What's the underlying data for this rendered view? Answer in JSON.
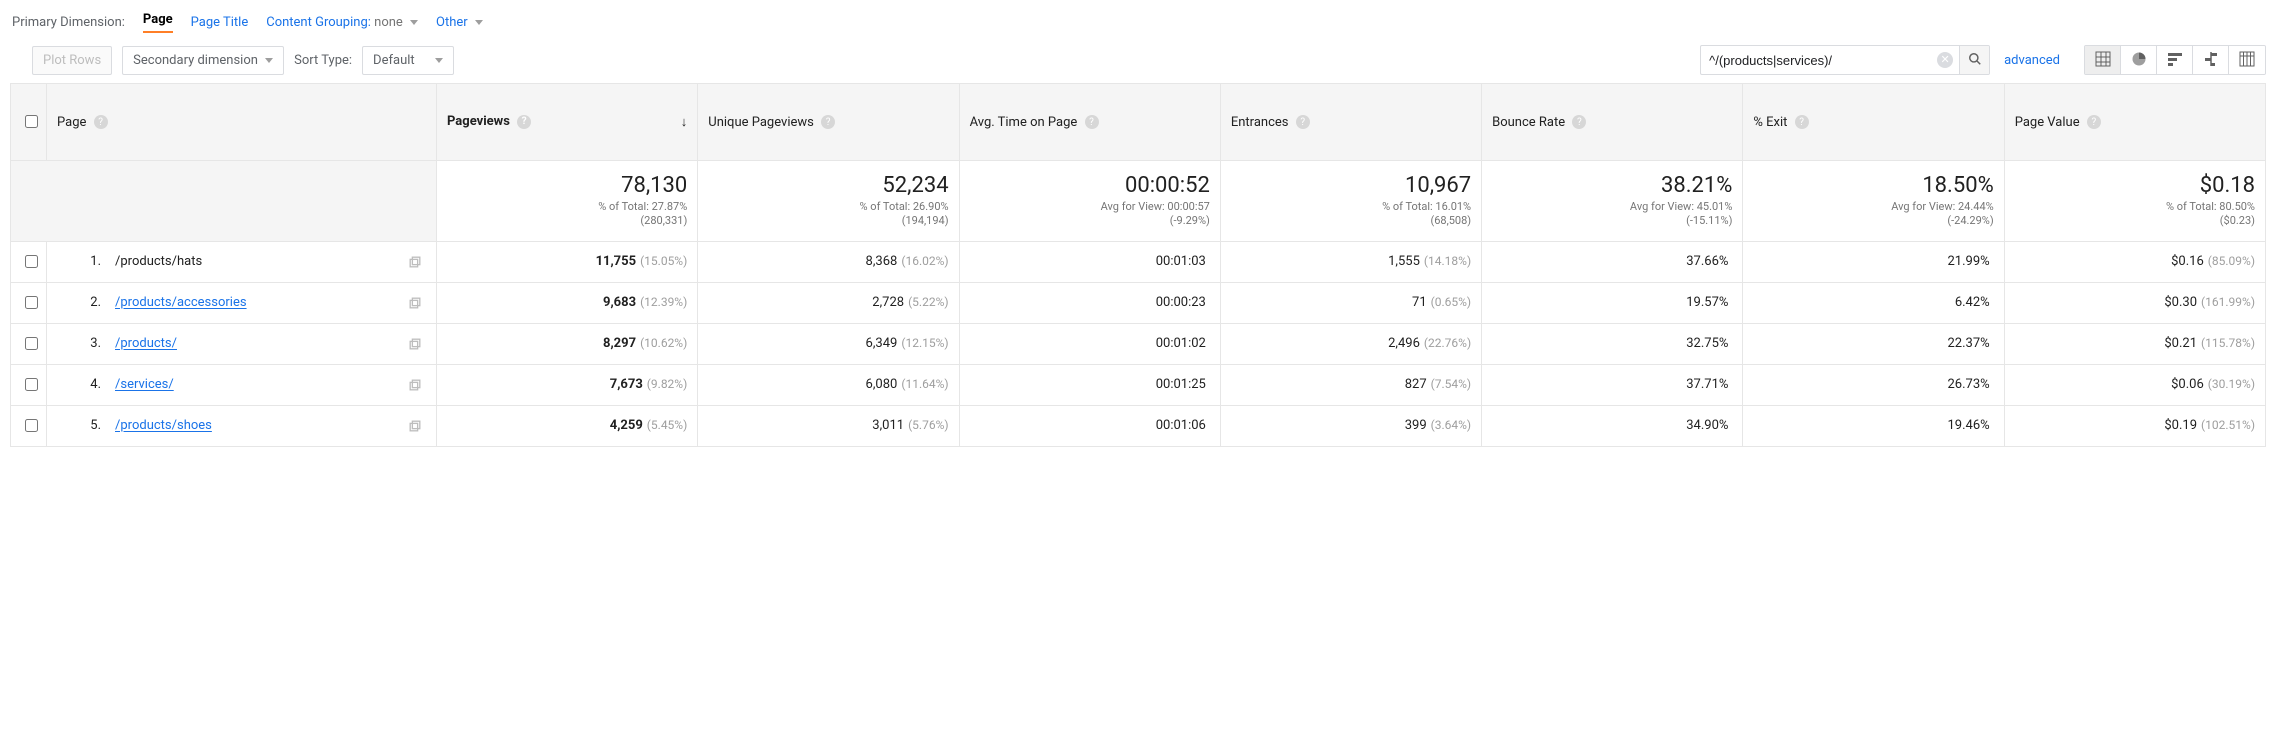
{
  "primary_dimension": {
    "label": "Primary Dimension:",
    "active": "Page",
    "page_title": "Page Title",
    "content_grouping_label": "Content Grouping:",
    "content_grouping_value": "none",
    "other": "Other"
  },
  "toolbar": {
    "plot_rows": "Plot Rows",
    "secondary_dimension": "Secondary dimension",
    "sort_type_label": "Sort Type:",
    "sort_type_value": "Default",
    "search_value": "^/(products|services)/",
    "advanced": "advanced"
  },
  "columns": {
    "page": "Page",
    "pageviews": "Pageviews",
    "unique_pageviews": "Unique Pageviews",
    "avg_time": "Avg. Time on Page",
    "entrances": "Entrances",
    "bounce_rate": "Bounce Rate",
    "pct_exit": "% Exit",
    "page_value": "Page Value"
  },
  "summary": {
    "pageviews": {
      "big": "78,130",
      "sub1": "% of Total: 27.87%",
      "sub2": "(280,331)"
    },
    "unique_pageviews": {
      "big": "52,234",
      "sub1": "% of Total: 26.90%",
      "sub2": "(194,194)"
    },
    "avg_time": {
      "big": "00:00:52",
      "sub1": "Avg for View: 00:00:57",
      "sub2": "(-9.29%)"
    },
    "entrances": {
      "big": "10,967",
      "sub1": "% of Total: 16.01%",
      "sub2": "(68,508)"
    },
    "bounce_rate": {
      "big": "38.21%",
      "sub1": "Avg for View: 45.01%",
      "sub2": "(-15.11%)"
    },
    "pct_exit": {
      "big": "18.50%",
      "sub1": "Avg for View: 24.44%",
      "sub2": "(-24.29%)"
    },
    "page_value": {
      "big": "$0.18",
      "sub1": "% of Total: 80.50%",
      "sub2": "($0.23)"
    }
  },
  "rows": [
    {
      "n": "1.",
      "page": "/products/hats",
      "link": false,
      "pageviews": {
        "v": "11,755",
        "p": "(15.05%)"
      },
      "unique": {
        "v": "8,368",
        "p": "(16.02%)"
      },
      "avg_time": {
        "v": "00:01:03",
        "p": ""
      },
      "entrances": {
        "v": "1,555",
        "p": "(14.18%)"
      },
      "bounce": {
        "v": "37.66%",
        "p": ""
      },
      "exit": {
        "v": "21.99%",
        "p": ""
      },
      "value": {
        "v": "$0.16",
        "p": "(85.09%)"
      }
    },
    {
      "n": "2.",
      "page": "/products/accessories",
      "link": true,
      "pageviews": {
        "v": "9,683",
        "p": "(12.39%)"
      },
      "unique": {
        "v": "2,728",
        "p": "(5.22%)"
      },
      "avg_time": {
        "v": "00:00:23",
        "p": ""
      },
      "entrances": {
        "v": "71",
        "p": "(0.65%)"
      },
      "bounce": {
        "v": "19.57%",
        "p": ""
      },
      "exit": {
        "v": "6.42%",
        "p": ""
      },
      "value": {
        "v": "$0.30",
        "p": "(161.99%)"
      }
    },
    {
      "n": "3.",
      "page": "/products/",
      "link": true,
      "pageviews": {
        "v": "8,297",
        "p": "(10.62%)"
      },
      "unique": {
        "v": "6,349",
        "p": "(12.15%)"
      },
      "avg_time": {
        "v": "00:01:02",
        "p": ""
      },
      "entrances": {
        "v": "2,496",
        "p": "(22.76%)"
      },
      "bounce": {
        "v": "32.75%",
        "p": ""
      },
      "exit": {
        "v": "22.37%",
        "p": ""
      },
      "value": {
        "v": "$0.21",
        "p": "(115.78%)"
      }
    },
    {
      "n": "4.",
      "page": "/services/",
      "link": true,
      "pageviews": {
        "v": "7,673",
        "p": "(9.82%)"
      },
      "unique": {
        "v": "6,080",
        "p": "(11.64%)"
      },
      "avg_time": {
        "v": "00:01:25",
        "p": ""
      },
      "entrances": {
        "v": "827",
        "p": "(7.54%)"
      },
      "bounce": {
        "v": "37.71%",
        "p": ""
      },
      "exit": {
        "v": "26.73%",
        "p": ""
      },
      "value": {
        "v": "$0.06",
        "p": "(30.19%)"
      }
    },
    {
      "n": "5.",
      "page": "/products/shoes",
      "link": true,
      "pageviews": {
        "v": "4,259",
        "p": "(5.45%)"
      },
      "unique": {
        "v": "3,011",
        "p": "(5.76%)"
      },
      "avg_time": {
        "v": "00:01:06",
        "p": ""
      },
      "entrances": {
        "v": "399",
        "p": "(3.64%)"
      },
      "bounce": {
        "v": "34.90%",
        "p": ""
      },
      "exit": {
        "v": "19.46%",
        "p": ""
      },
      "value": {
        "v": "$0.19",
        "p": "(102.51%)"
      }
    }
  ]
}
